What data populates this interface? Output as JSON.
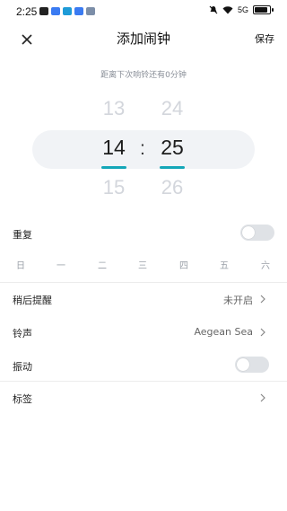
{
  "status_bar": {
    "time": "2:25",
    "signal": "5G"
  },
  "header": {
    "title": "添加闹钟",
    "save_label": "保存"
  },
  "next_ring_text": "距离下次响铃还有0分钟",
  "picker": {
    "hour": {
      "prev": "13",
      "selected": "14",
      "next": "15"
    },
    "minute": {
      "prev": "24",
      "selected": "25",
      "next": "26"
    },
    "separator": ":"
  },
  "repeat": {
    "label": "重复",
    "enabled": false,
    "days": [
      "日",
      "一",
      "二",
      "三",
      "四",
      "五",
      "六"
    ]
  },
  "snooze": {
    "label": "稍后提醒",
    "value": "未开启"
  },
  "ringtone": {
    "label": "铃声",
    "value": "Aegean Sea"
  },
  "vibrate": {
    "label": "振动",
    "enabled": false
  },
  "tag": {
    "label": "标签"
  },
  "colors": {
    "accent": "#14a7b8",
    "toggle_off": "#dfe2e6",
    "picker_bg": "#f1f3f6"
  }
}
